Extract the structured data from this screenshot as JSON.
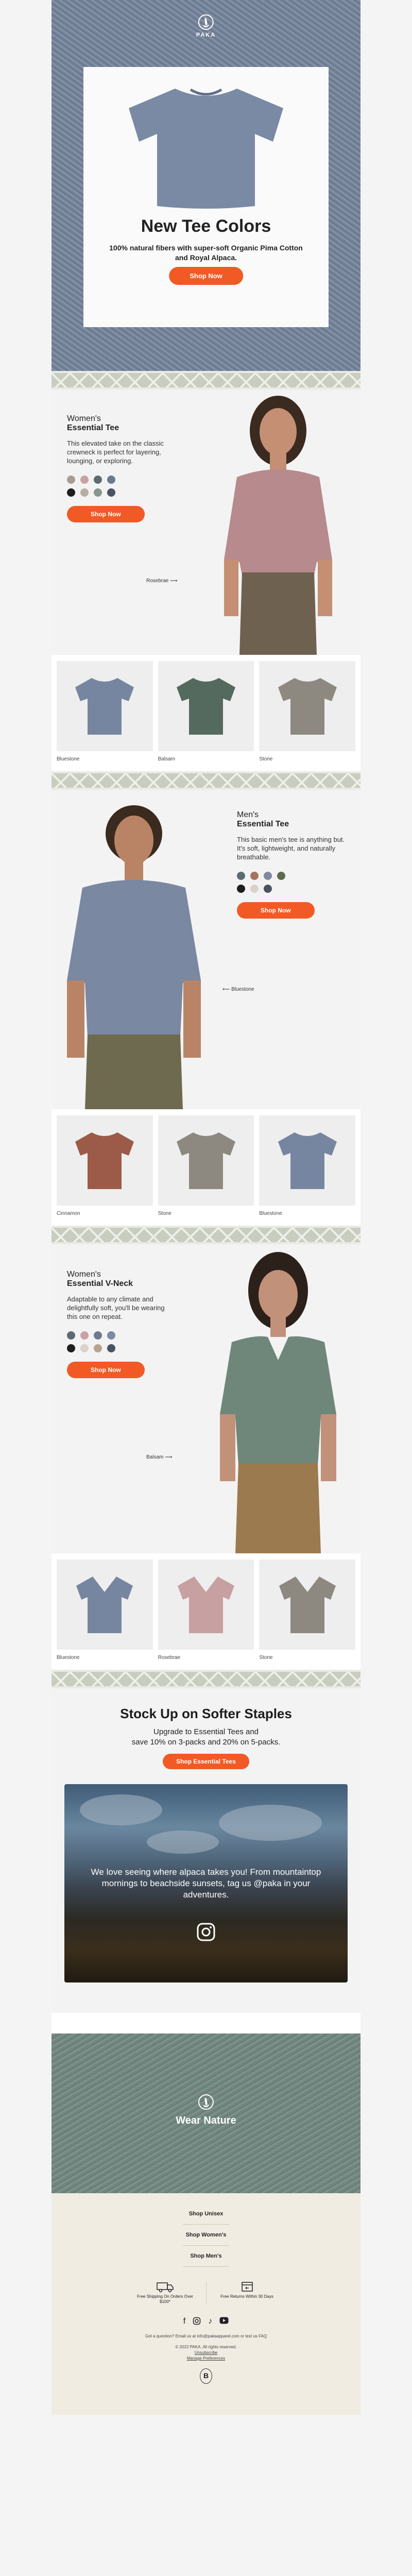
{
  "brand": {
    "logo_text": "PAKA"
  },
  "hero": {
    "title": "New Tee Colors",
    "subtitle": "100% natural fibers with super-soft Organic Pima Cotton and Royal Alpaca.",
    "cta": "Shop Now"
  },
  "womens_tee": {
    "eyebrow": "Women's",
    "title": "Essential Tee",
    "desc": "This elevated take on the classic crewneck is perfect for layering, lounging, or exploring.",
    "swatches": [
      "#a89d96",
      "#c7a3a6",
      "#5d6a70",
      "#6c7a8f",
      "#1e1e1e",
      "#b5aea4",
      "#87968e",
      "#4a5361"
    ],
    "cta": "Shop Now",
    "model_caption": "Rosebrae",
    "thumbs": [
      {
        "label": "Bluestone",
        "color": "#7786a0"
      },
      {
        "label": "Balsam",
        "color": "#556a5e"
      },
      {
        "label": "Stone",
        "color": "#8d8980"
      }
    ]
  },
  "mens_tee": {
    "eyebrow": "Men's",
    "title": "Essential Tee",
    "desc": "This basic men's tee is anything but. It's soft, lightweight, and naturally breathable.",
    "swatches": [
      "#5d6a70",
      "#a67360",
      "#7d8aa0",
      "#5b6b4e",
      "#1e1e1e",
      "#d9d3c8",
      "#4a5361"
    ],
    "cta": "Shop Now",
    "model_caption": "Bluestone",
    "thumbs": [
      {
        "label": "Cinnamon",
        "color": "#9c5b48"
      },
      {
        "label": "Stone",
        "color": "#8d8980"
      },
      {
        "label": "Bluestone",
        "color": "#7786a0"
      }
    ]
  },
  "womens_vneck": {
    "eyebrow": "Women's",
    "title": "Essential V-Neck",
    "desc": "Adaptable to any climate and delightfully soft, you'll be wearing this one on repeat.",
    "swatches": [
      "#5d6a70",
      "#c7a3a6",
      "#6c7a8f",
      "#7d8aa0",
      "#1e1e1e",
      "#d9d3c8",
      "#b8a48e",
      "#4a5361"
    ],
    "cta": "Shop Now",
    "model_caption": "Balsam",
    "thumbs": [
      {
        "label": "Bluestone",
        "color": "#7786a0"
      },
      {
        "label": "Rosebrae",
        "color": "#c7a0a2"
      },
      {
        "label": "Stone",
        "color": "#8d8980"
      }
    ]
  },
  "stock_up": {
    "title": "Stock Up on Softer Staples",
    "subtitle_line1": "Upgrade to Essential Tees and",
    "subtitle_line2": "save 10% on 3-packs and 20% on 5-packs.",
    "cta": "Shop Essential Tees"
  },
  "ugc": {
    "text": "We love seeing where alpaca takes you! From mountaintop mornings to beachside sunsets, tag us @paka in your adventures."
  },
  "wear_nature": {
    "text": "Wear Nature"
  },
  "footer": {
    "links": [
      "Shop Unisex",
      "Shop Women's",
      "Shop Men's"
    ],
    "perk_shipping": "Free Shipping On Orders Over $100*",
    "perk_returns": "Free Returns Within 30 Days",
    "question": "Got a question? Email us at info@pakaapparel.com or text us FAQ",
    "copyright": "© 2022 PAKA. All rights reserved.",
    "unsubscribe": "Unsubscribe",
    "manage": "Manage Preferences",
    "bcorp": "B"
  }
}
